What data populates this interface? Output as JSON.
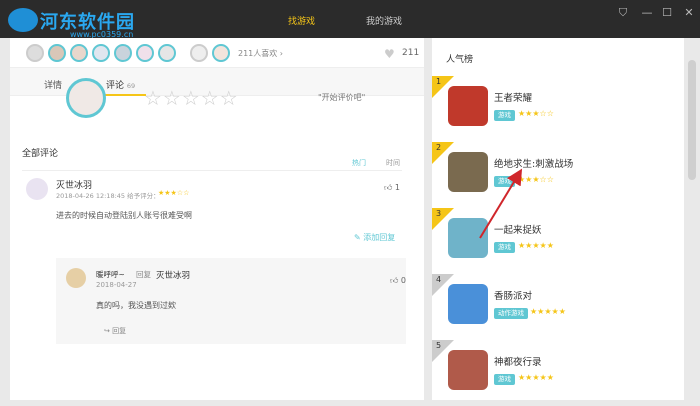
{
  "header": {
    "watermark": "河东软件园",
    "watermark_url": "www.pc0359.cn",
    "nav": [
      "找游戏",
      "我的游戏"
    ],
    "window_buttons": [
      "settings-icon",
      "minimize-icon",
      "maximize-icon",
      "close-icon"
    ]
  },
  "likes": {
    "count_text": "211人喜欢 ›",
    "heart_count": "211"
  },
  "tabs": [
    {
      "label": "详情"
    },
    {
      "label": "评论",
      "badge": "69"
    }
  ],
  "rating": {
    "stars": "☆☆☆☆☆",
    "hint": "\"开始评价吧\""
  },
  "comments": {
    "section_title": "全部评论",
    "sort": [
      "热门",
      "时间"
    ],
    "item": {
      "name": "灭世冰羽",
      "meta": "2018-04-26 12:18:45  给予评分：",
      "stars": "★★★☆☆",
      "likes": "1",
      "text": "进去的时候自动登陆别人账号很难受啊",
      "add_reply": "添加回复"
    },
    "reply": {
      "name": "暖呼呼~",
      "reply_word": "回复",
      "target": "灭世冰羽",
      "date": "2018-04-27",
      "likes": "0",
      "text": "真的吗，我没遇到过欸",
      "reply_btn": "回复"
    }
  },
  "popular": {
    "title": "人气榜",
    "items": [
      {
        "rank": "1",
        "name": "王者荣耀",
        "tag": "游戏",
        "stars": "★★★☆☆",
        "color": "#c0392b"
      },
      {
        "rank": "2",
        "name": "绝地求生:刺激战场",
        "tag": "游戏",
        "stars": "★★★☆☆",
        "color": "#7a6a4f"
      },
      {
        "rank": "3",
        "name": "一起来捉妖",
        "tag": "游戏",
        "stars": "★★★★★",
        "color": "#6fb3c9"
      },
      {
        "rank": "4",
        "name": "香肠派对",
        "tag": "动作游戏",
        "stars": "★★★★★",
        "color": "#4a90d9"
      },
      {
        "rank": "5",
        "name": "神都夜行录",
        "tag": "游戏",
        "stars": "★★★★★",
        "color": "#b05a4a"
      }
    ]
  },
  "colors": {
    "accent": "#f5c518",
    "teal": "#5fc7d3",
    "titlebar": "#2b2b2b",
    "arrow": "#d0262b"
  }
}
